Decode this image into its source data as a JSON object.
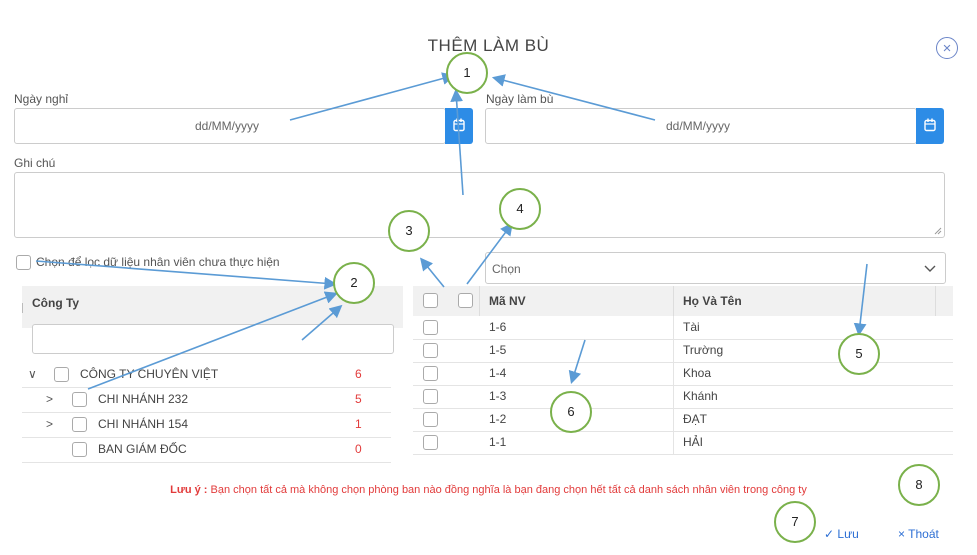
{
  "dialog": {
    "title": "THÊM LÀM BÙ",
    "close_icon": "×"
  },
  "leave_date": {
    "label": "Ngày nghỉ",
    "placeholder": "dd/MM/yyyy"
  },
  "makeup_date": {
    "label": "Ngày làm bù",
    "placeholder": "dd/MM/yyyy"
  },
  "note": {
    "label": "Ghi chú",
    "value": ""
  },
  "filter": {
    "label": "Chọn để lọc dữ liệu nhân viên chưa thực hiện"
  },
  "company_panel": {
    "header": "Công Ty",
    "search_value": "",
    "tree": [
      {
        "name": "CÔNG TY CHUYÊN VIỆT",
        "count": "6",
        "level": 0,
        "expander": "∨"
      },
      {
        "name": "CHI NHÁNH 232",
        "count": "5",
        "level": 1,
        "expander": ">"
      },
      {
        "name": "CHI NHÁNH 154",
        "count": "1",
        "level": 1,
        "expander": ">"
      },
      {
        "name": "BAN GIÁM ĐỐC",
        "count": "0",
        "level": 1,
        "expander": ""
      }
    ]
  },
  "employee_panel": {
    "select_placeholder": "Chọn",
    "columns": {
      "code": "Mã NV",
      "name": "Họ Và Tên"
    },
    "rows": [
      {
        "code": "1-6",
        "name": "Tài"
      },
      {
        "code": "1-5",
        "name": "Trường"
      },
      {
        "code": "1-4",
        "name": "Khoa"
      },
      {
        "code": "1-3",
        "name": "Khánh"
      },
      {
        "code": "1-2",
        "name": "ĐẠT"
      },
      {
        "code": "1-1",
        "name": "HẢI"
      }
    ]
  },
  "warning": {
    "prefix": "Lưu ý :",
    "text": " Bạn chọn tất cả mà không chọn phòng ban nào đồng nghĩa là bạn đang chọn hết tất cả danh sách nhân viên trong công ty"
  },
  "actions": {
    "save_icon": "✓",
    "save_label": "Lưu",
    "exit_icon": "×",
    "exit_label": "Thoát"
  },
  "annotations": [
    "1",
    "2",
    "3",
    "4",
    "5",
    "6",
    "7",
    "8"
  ],
  "colors": {
    "accent": "#2d8ce6",
    "danger": "#e23b3b",
    "marker_border": "#7ab14b",
    "arrow": "#5b9bd5"
  }
}
